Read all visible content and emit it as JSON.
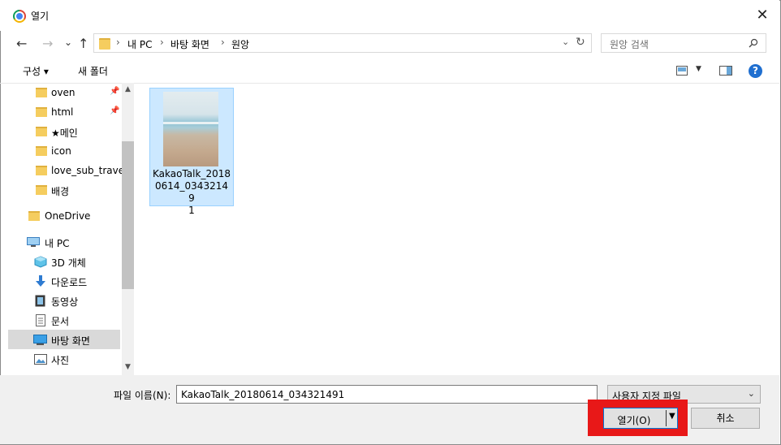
{
  "window": {
    "title": "열기"
  },
  "nav": {
    "back": "←",
    "forward": "→",
    "recent": "⌄",
    "up": "↑"
  },
  "address": {
    "crumbs": [
      "내 PC",
      "바탕 화면",
      "원앙"
    ],
    "separator": "›"
  },
  "search": {
    "placeholder": "원앙 검색"
  },
  "toolbar": {
    "organize": "구성 ▾",
    "new_folder": "새 폴더",
    "help": "?"
  },
  "sidebar": {
    "items": [
      {
        "label": "oven",
        "icon": "folder-icon",
        "pinned": true
      },
      {
        "label": "html",
        "icon": "folder-icon",
        "pinned": true
      },
      {
        "label": "★메인",
        "icon": "folder-icon"
      },
      {
        "label": "icon",
        "icon": "folder-icon"
      },
      {
        "label": "love_sub_travel",
        "icon": "folder-icon"
      },
      {
        "label": "배경",
        "icon": "folder-icon"
      },
      {
        "label": "OneDrive",
        "icon": "folder-icon"
      },
      {
        "label": "내 PC",
        "icon": "pc-icon"
      },
      {
        "label": "3D 개체",
        "icon": "cube-icon"
      },
      {
        "label": "다운로드",
        "icon": "download-icon"
      },
      {
        "label": "동영상",
        "icon": "video-icon"
      },
      {
        "label": "문서",
        "icon": "document-icon"
      },
      {
        "label": "바탕 화면",
        "icon": "desktop-icon",
        "selected": true
      },
      {
        "label": "사진",
        "icon": "picture-icon"
      }
    ]
  },
  "files": [
    {
      "name": "KakaoTalk_20180614_034321491",
      "display": "KakaoTalk_2018\n0614_03432149\n1",
      "selected": true
    }
  ],
  "footer": {
    "filename_label": "파일 이름(N):",
    "filename_value": "KakaoTalk_20180614_034321491",
    "filetype_value": "사용자 지정 파일",
    "open_label": "열기(O)",
    "cancel_label": "취소"
  },
  "colors": {
    "highlight": "#e81818",
    "selection": "#cce8ff",
    "accent": "#0078d7"
  }
}
